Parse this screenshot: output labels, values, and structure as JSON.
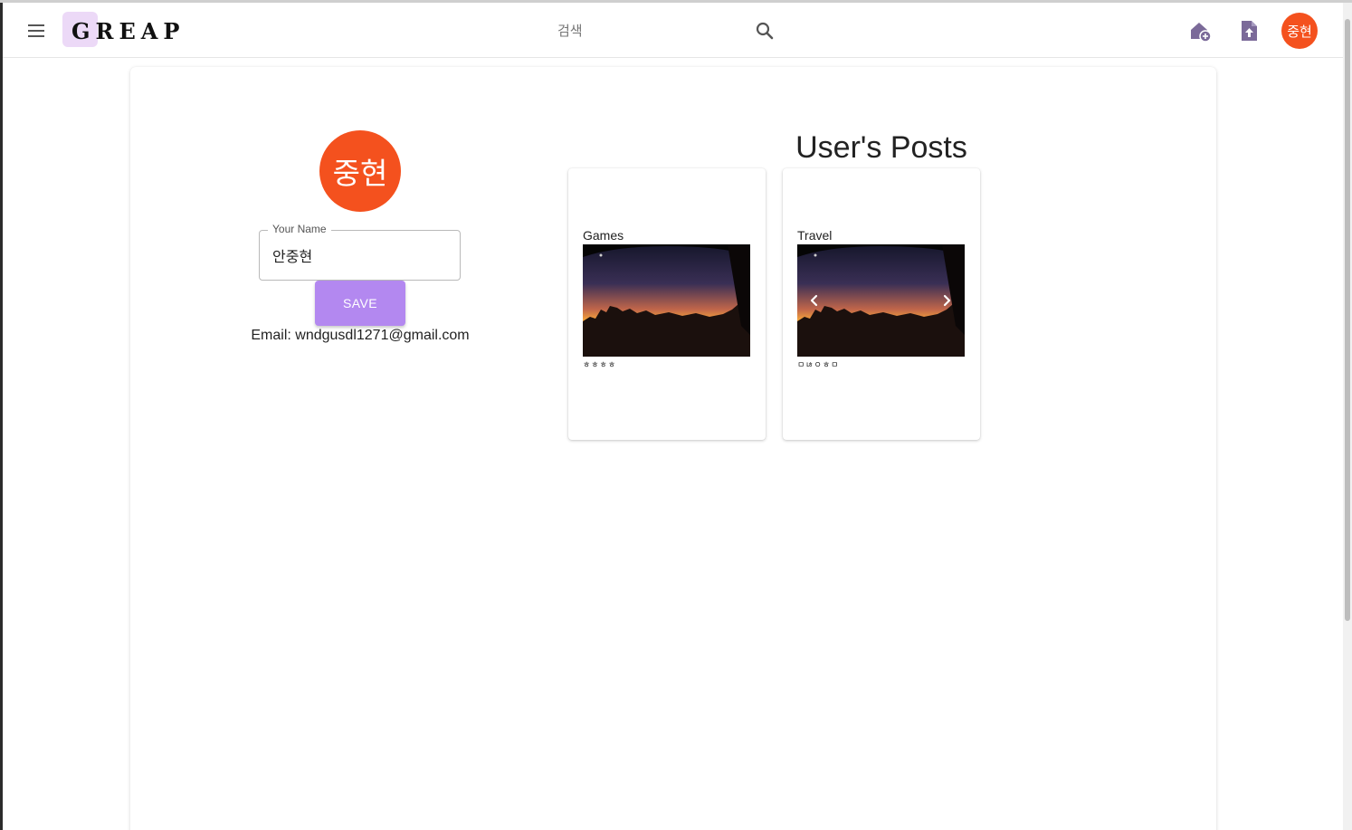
{
  "header": {
    "logo_text": "GREAP",
    "search_placeholder": "검색",
    "avatar_initials": "중현",
    "icons": [
      "menu-icon",
      "search-icon",
      "add-home-icon",
      "upload-file-icon"
    ]
  },
  "profile": {
    "avatar_initials": "중현",
    "name_label": "Your Name",
    "name_value": "안중현",
    "save_label": "SAVE",
    "email_text": "Email: wndgusdl1271@gmail.com"
  },
  "posts": {
    "title": "User's Posts",
    "items": [
      {
        "category": "Games",
        "body": "ㅎㅎㅎㅎ",
        "has_carousel": false
      },
      {
        "category": "Travel",
        "body": "ㅁㄶㅇㅎㅁ",
        "has_carousel": true
      }
    ]
  },
  "colors": {
    "accent": "#b388f0",
    "avatar": "#f4511e",
    "logo_bg": "#ecd9f7",
    "icon": "#7b6a99"
  }
}
